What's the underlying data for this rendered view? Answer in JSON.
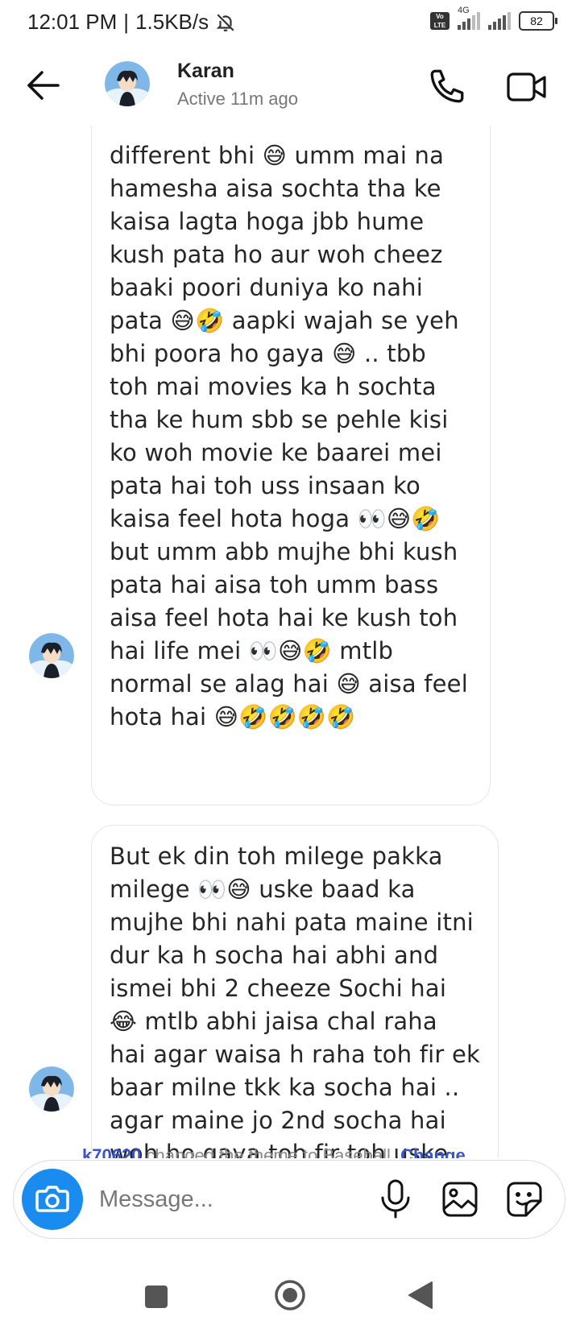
{
  "status_bar": {
    "time": "12:01 PM",
    "separator": "|",
    "speed": "1.5KB/s",
    "network": "4G",
    "volte": "Vo LTE",
    "battery": "82"
  },
  "header": {
    "contact_name": "Karan",
    "contact_status": "Active 11m ago"
  },
  "messages": [
    {
      "text": "different bhi 😅 umm mai na hamesha aisa sochta tha ke kaisa lagta hoga jbb hume kush pata ho aur woh cheez baaki poori duniya ko nahi pata 😅🤣 aapki wajah se yeh bhi poora ho gaya 😅 .. tbb toh mai movies ka h sochta tha ke hum sbb se pehle kisi ko woh movie ke baarei mei pata hai toh uss insaan ko kaisa feel hota hoga 👀😅🤣 but umm abb mujhe bhi kush pata hai aisa toh umm bass aisa feel hota hai ke kush toh hai life mei 👀😅🤣 mtlb normal se alag hai 😅 aisa feel hota hai 😅🤣🤣🤣🤣"
    },
    {
      "text": "But ek din toh milege pakka milege 👀😅 uske baad ka mujhe bhi nahi pata maine itni dur ka h socha hai abhi and ismei bhi 2 cheeze Sochi hai 😂 mtlb abhi jaisa chal raha hai agar waisa h raha toh fir ek baar milne tkk ka socha hai .. agar maine jo 2nd socha hai woh ho gaya toh fir toh uske bohot aage tkk ka socha hai 👀😅😅😅🤣🤣🤣🤣👍🏻👍🏻"
    }
  ],
  "theme_notice": {
    "user": "k70620",
    "text": " changed the theme to Baseball. ",
    "link": "Change"
  },
  "composer": {
    "placeholder": "Message..."
  },
  "colors": {
    "accent": "#1a8cf0",
    "link": "#3a56c6",
    "bubble_border": "#e6e6e6"
  },
  "icons": {
    "back": "arrow-left-icon",
    "call": "phone-icon",
    "video": "video-camera-icon",
    "camera": "camera-icon",
    "mic": "microphone-icon",
    "gallery": "image-icon",
    "sticker": "sticker-icon",
    "mute": "bell-off-icon"
  }
}
